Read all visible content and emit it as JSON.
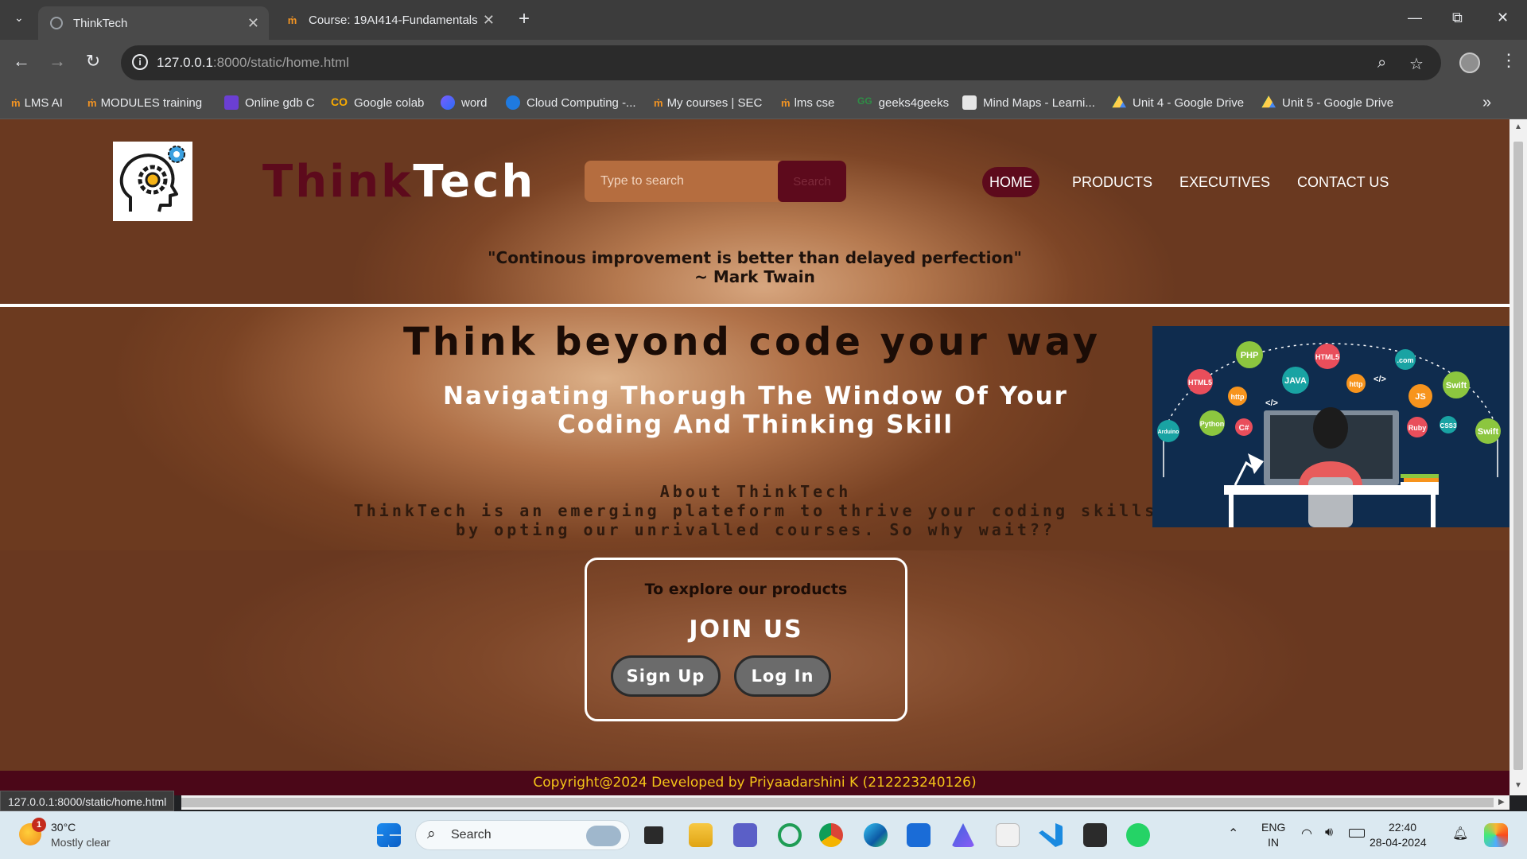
{
  "browser": {
    "tabs": [
      {
        "title": "ThinkTech",
        "active": true
      },
      {
        "title": "Course: 19AI414-Fundamentals",
        "active": false
      }
    ],
    "address": {
      "host": "127.0.0.1",
      "rest": ":8000/static/home.html"
    },
    "bookmarks": [
      {
        "label": "LMS AI",
        "icon": "moodle-icon"
      },
      {
        "label": "MODULES training",
        "icon": "moodle-icon"
      },
      {
        "label": "Online gdb C",
        "icon": "gdb-icon"
      },
      {
        "label": "Google colab",
        "icon": "colab-icon"
      },
      {
        "label": "word",
        "icon": "word-icon"
      },
      {
        "label": "Cloud Computing -...",
        "icon": "cloud-icon"
      },
      {
        "label": "My courses | SEC",
        "icon": "moodle-icon"
      },
      {
        "label": "lms cse",
        "icon": "moodle-icon"
      },
      {
        "label": "geeks4geeks",
        "icon": "gfg-icon"
      },
      {
        "label": "Mind Maps - Learni...",
        "icon": "mindmap-icon"
      },
      {
        "label": "Unit 4 - Google Drive",
        "icon": "drive-icon"
      },
      {
        "label": "Unit 5 - Google Drive",
        "icon": "drive-icon"
      }
    ],
    "status_url": "127.0.0.1:8000/static/home.html"
  },
  "site": {
    "brand_part1": "Think",
    "brand_part2": "Tech",
    "search": {
      "placeholder": "Type to search",
      "button": "Search"
    },
    "nav": [
      "HOME",
      "PRODUCTS",
      "EXECUTIVES",
      "CONTACT US"
    ],
    "quote_line1": "\"Continous improvement is better than delayed perfection\"",
    "quote_line2": "~ Mark Twain",
    "headline": "Think beyond code your way",
    "subheadline": "Navigating Thorugh The Window Of Your Coding And Thinking Skill",
    "about_title": "About ThinkTech",
    "about_text": "ThinkTech is an emerging plateform to thrive your coding skills by opting our unrivalled courses. So why wait??",
    "join": {
      "title": "To explore our products",
      "cta": "JOIN US",
      "signup": "Sign Up",
      "login": "Log In"
    },
    "hero_image_tags": [
      "PHP",
      "HTML5",
      "JAVA",
      "http",
      ".com",
      "Swift",
      "JS",
      "Arduino",
      "Python",
      "C#",
      "Ruby",
      "CSS3",
      "HTML5",
      "Swift",
      "http",
      "</>"
    ],
    "footer": "Copyright@2024 Developed by Priyaadarshini K (212223240126)"
  },
  "taskbar": {
    "weather_temp": "30°C",
    "weather_desc": "Mostly clear",
    "weather_badge": "1",
    "search_label": "Search",
    "lang1": "ENG",
    "lang2": "IN",
    "time": "22:40",
    "date": "28-04-2024"
  },
  "colors": {
    "brand_maroon": "#5d0a1c",
    "page_brown": "#6a3920",
    "footer_gold": "#f3c318"
  }
}
